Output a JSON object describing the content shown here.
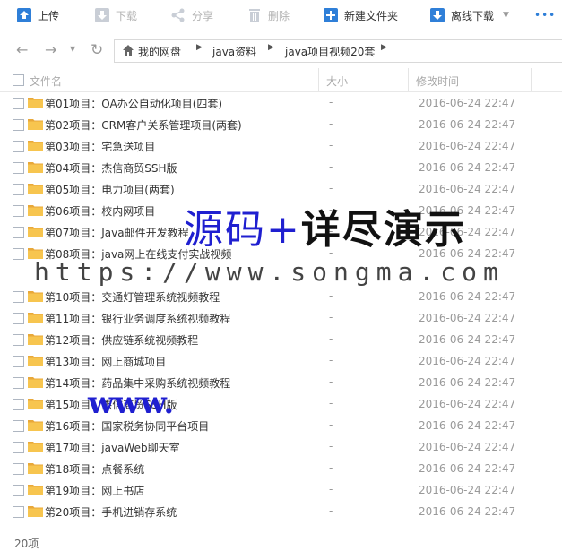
{
  "toolbar": {
    "upload": "上传",
    "download": "下载",
    "share": "分享",
    "delete": "删除",
    "new_folder": "新建文件夹",
    "offline_download": "离线下载",
    "more": "•••"
  },
  "breadcrumb": {
    "items": [
      "我的网盘",
      "java资料",
      "java项目视频20套"
    ]
  },
  "columns": {
    "name": "文件名",
    "size": "大小",
    "modified": "修改时间"
  },
  "files": [
    {
      "name": "第01项目：OA办公自动化项目(四套)",
      "size": "-",
      "date": "2016-06-24 22:47"
    },
    {
      "name": "第02项目：CRM客户关系管理项目(两套)",
      "size": "-",
      "date": "2016-06-24 22:47"
    },
    {
      "name": "第03项目：宅急送项目",
      "size": "-",
      "date": "2016-06-24 22:47"
    },
    {
      "name": "第04项目：杰信商贸SSH版",
      "size": "-",
      "date": "2016-06-24 22:47"
    },
    {
      "name": "第05项目：电力项目(两套)",
      "size": "-",
      "date": "2016-06-24 22:47"
    },
    {
      "name": "第06项目：校内网项目",
      "size": "-",
      "date": "2016-06-24 22:47"
    },
    {
      "name": "第07项目：Java邮件开发教程",
      "size": "-",
      "date": "2016-06-24 22:47"
    },
    {
      "name": "第08项目：java网上在线支付实战视频",
      "size": "-",
      "date": "2016-06-24 22:47"
    },
    {
      "name": "第10项目：交通灯管理系统视频教程",
      "size": "-",
      "date": "2016-06-24 22:47"
    },
    {
      "name": "第11项目：银行业务调度系统视频教程",
      "size": "-",
      "date": "2016-06-24 22:47"
    },
    {
      "name": "第12项目：供应链系统视频教程",
      "size": "-",
      "date": "2016-06-24 22:47"
    },
    {
      "name": "第13项目：网上商城项目",
      "size": "-",
      "date": "2016-06-24 22:47"
    },
    {
      "name": "第14项目：药品集中采购系统视频教程",
      "size": "-",
      "date": "2016-06-24 22:47"
    },
    {
      "name": "第15项目：杰信商贸SSH版",
      "size": "-",
      "date": "2016-06-24 22:47"
    },
    {
      "name": "第16项目：国家税务协同平台项目",
      "size": "-",
      "date": "2016-06-24 22:47"
    },
    {
      "name": "第17项目：javaWeb聊天室",
      "size": "-",
      "date": "2016-06-24 22:47"
    },
    {
      "name": "第18项目：点餐系统",
      "size": "-",
      "date": "2016-06-24 22:47"
    },
    {
      "name": "第19项目：网上书店",
      "size": "-",
      "date": "2016-06-24 22:47"
    },
    {
      "name": "第20项目：手机进销存系统",
      "size": "-",
      "date": "2016-06-24 22:47"
    }
  ],
  "footer": {
    "count": "20项"
  },
  "watermark": {
    "line1_a": "源码",
    "line1_plus": "+",
    "line1_b": "详尽演示",
    "line2": "https://www.songma.com",
    "line3": "www."
  },
  "colors": {
    "accent": "#1a73d9",
    "folder": "#f5c04a",
    "watermark_blue": "#1f1fd0"
  }
}
